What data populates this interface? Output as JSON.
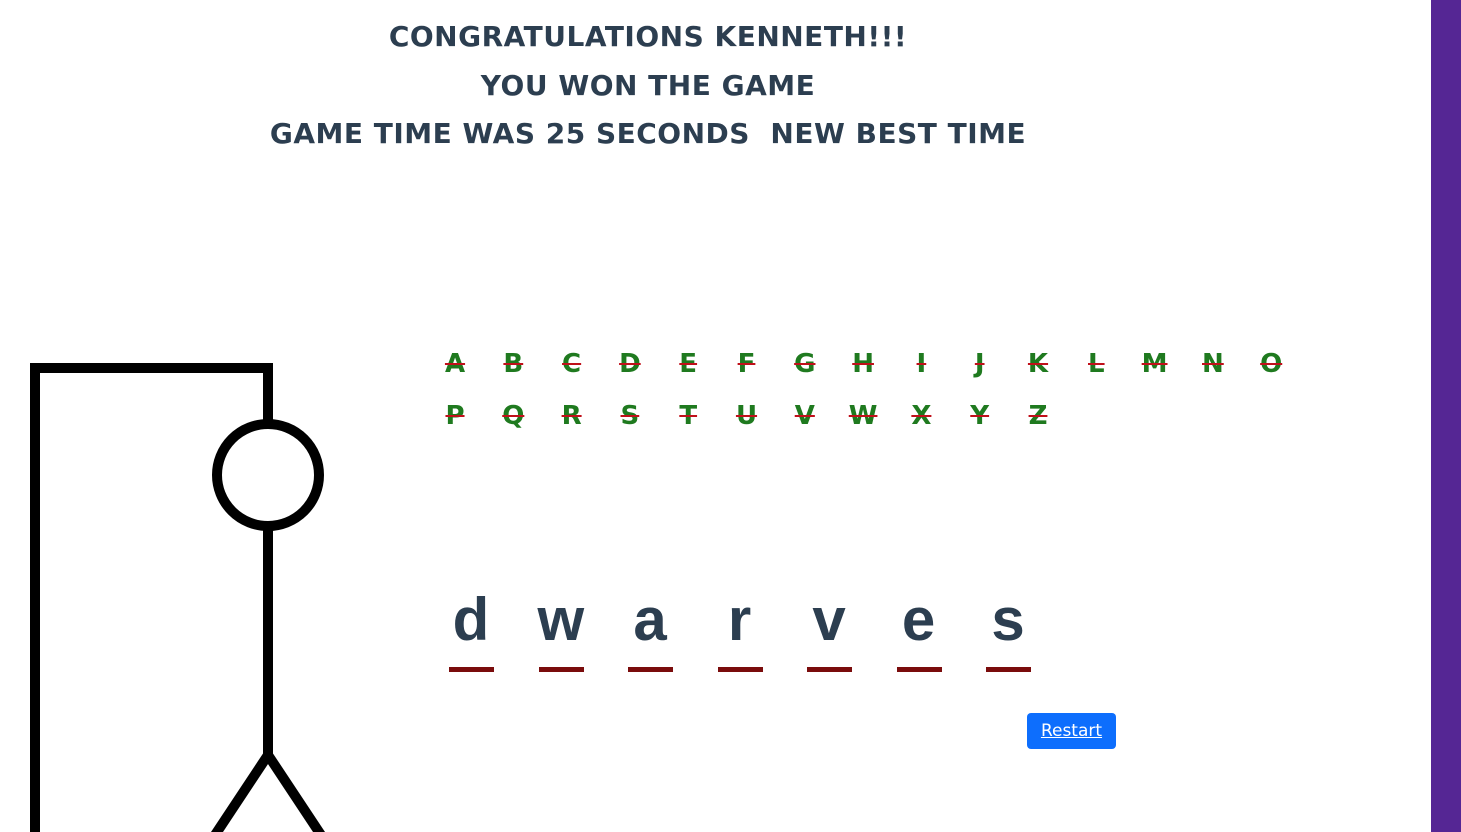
{
  "messages": {
    "line1": "CONGRATULATIONS KENNETH!!!",
    "line2": "YOU WON THE GAME",
    "line3": "GAME TIME WAS 25 SECONDS  NEW BEST TIME"
  },
  "alphabet": [
    "A",
    "B",
    "C",
    "D",
    "E",
    "F",
    "G",
    "H",
    "I",
    "J",
    "K",
    "L",
    "M",
    "N",
    "O",
    "P",
    "Q",
    "R",
    "S",
    "T",
    "U",
    "V",
    "W",
    "X",
    "Y",
    "Z"
  ],
  "word": [
    "d",
    "w",
    "a",
    "r",
    "v",
    "e",
    "s"
  ],
  "restart_label": "Restart",
  "colors": {
    "heading": "#2c3e50",
    "used_letter": "#1f7a1f",
    "strike": "#c0101a",
    "underline": "#7a0c0c",
    "button": "#0d6efd",
    "sidebar": "#552694"
  }
}
